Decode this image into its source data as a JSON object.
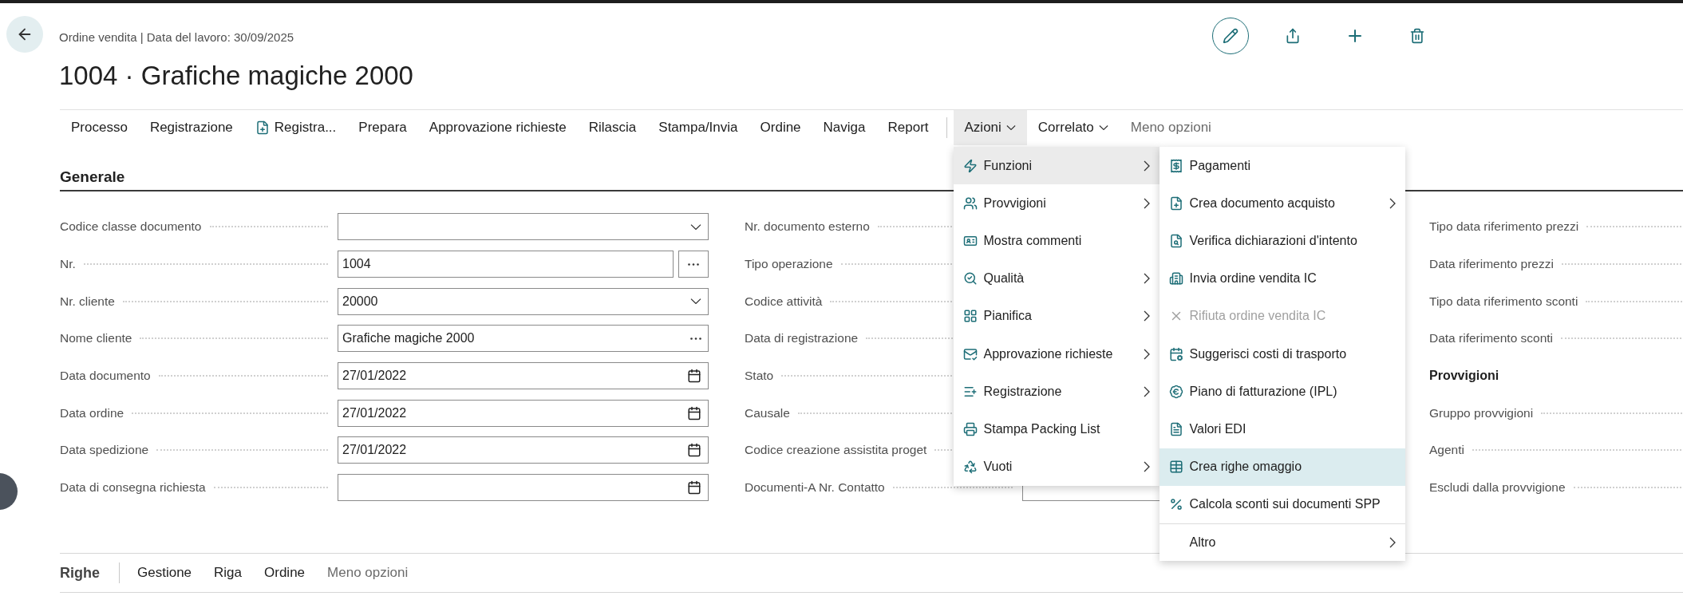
{
  "header": {
    "breadcrumb": "Ordine vendita | Data del lavoro: 30/09/2025",
    "title": "1004 · Grafiche magiche 2000"
  },
  "action_bar": {
    "primary": [
      {
        "label": "Processo",
        "kind": "text"
      },
      {
        "label": "Registrazione",
        "kind": "text"
      },
      {
        "label": "Registra...",
        "kind": "icon"
      },
      {
        "label": "Prepara",
        "kind": "text"
      },
      {
        "label": "Approvazione richieste",
        "kind": "text"
      },
      {
        "label": "Rilascia",
        "kind": "text"
      },
      {
        "label": "Stampa/Invia",
        "kind": "text"
      },
      {
        "label": "Ordine",
        "kind": "text"
      },
      {
        "label": "Naviga",
        "kind": "text"
      },
      {
        "label": "Report",
        "kind": "text"
      }
    ],
    "secondary": [
      {
        "label": "Azioni",
        "kind": "dropdown",
        "expanded": true
      },
      {
        "label": "Correlato",
        "kind": "dropdown",
        "expanded": false
      },
      {
        "label": "Meno opzioni",
        "kind": "muted",
        "expanded": false
      }
    ]
  },
  "actions_menu": {
    "items": [
      {
        "label": "Funzioni",
        "has_submenu": true,
        "selected": true
      },
      {
        "label": "Provvigioni",
        "has_submenu": true,
        "selected": false
      },
      {
        "label": "Mostra commenti",
        "has_submenu": false,
        "selected": false
      },
      {
        "label": "Qualità",
        "has_submenu": true,
        "selected": false
      },
      {
        "label": "Pianifica",
        "has_submenu": true,
        "selected": false
      },
      {
        "label": "Approvazione richieste",
        "has_submenu": true,
        "selected": false
      },
      {
        "label": "Registrazione",
        "has_submenu": true,
        "selected": false
      },
      {
        "label": "Stampa Packing List",
        "has_submenu": false,
        "selected": false
      },
      {
        "label": "Vuoti",
        "has_submenu": true,
        "selected": false
      }
    ],
    "submenu": [
      {
        "label": "Pagamenti",
        "kind": "action",
        "has_submenu": false,
        "disabled": false,
        "selected": false
      },
      {
        "label": "Crea documento acquisto",
        "kind": "action",
        "has_submenu": true,
        "disabled": false,
        "selected": false
      },
      {
        "label": "Verifica dichiarazioni d'intento",
        "kind": "action",
        "has_submenu": false,
        "disabled": false,
        "selected": false
      },
      {
        "label": "Invia ordine vendita IC",
        "kind": "action",
        "has_submenu": false,
        "disabled": false,
        "selected": false
      },
      {
        "label": "Rifiuta ordine vendita IC",
        "kind": "action",
        "has_submenu": false,
        "disabled": true,
        "selected": false
      },
      {
        "label": "Suggerisci costi di trasporto",
        "kind": "action",
        "has_submenu": false,
        "disabled": false,
        "selected": false
      },
      {
        "label": "Piano di fatturazione (IPL)",
        "kind": "action",
        "has_submenu": false,
        "disabled": false,
        "selected": false
      },
      {
        "label": "Valori EDI",
        "kind": "action",
        "has_submenu": false,
        "disabled": false,
        "selected": false
      },
      {
        "label": "Crea righe omaggio",
        "kind": "action",
        "has_submenu": false,
        "disabled": false,
        "selected": true
      },
      {
        "label": "Calcola sconti sui documenti SPP",
        "kind": "action",
        "has_submenu": false,
        "disabled": false,
        "selected": false
      },
      {
        "label": "Altro",
        "kind": "more",
        "has_submenu": true,
        "disabled": false,
        "selected": false
      }
    ]
  },
  "general": {
    "title": "Generale",
    "column_1": [
      {
        "label": "Codice classe documento",
        "kind": "dropdown"
      },
      {
        "label": "Nr.",
        "kind": "assist",
        "value": "1004"
      },
      {
        "label": "Nr. cliente",
        "kind": "dropdown",
        "value": "20000"
      },
      {
        "label": "Nome cliente",
        "kind": "lookup",
        "value": "Grafiche magiche 2000"
      },
      {
        "label": "Data documento",
        "kind": "date",
        "value": "27/01/2022"
      },
      {
        "label": "Data ordine",
        "kind": "date",
        "value": "27/01/2022"
      },
      {
        "label": "Data spedizione",
        "kind": "date",
        "value": "27/01/2022"
      },
      {
        "label": "Data di consegna richiesta",
        "kind": "date"
      }
    ],
    "column_2": [
      {
        "label": "Nr. documento esterno",
        "kind": "text"
      },
      {
        "label": "Tipo operazione",
        "kind": "text"
      },
      {
        "label": "Codice attività",
        "kind": "text"
      },
      {
        "label": "Data di registrazione",
        "kind": "text"
      },
      {
        "label": "Stato",
        "kind": "text"
      },
      {
        "label": "Causale",
        "kind": "text"
      },
      {
        "label": "Codice creazione assistita proget",
        "kind": "text"
      },
      {
        "label": "Documenti-A Nr. Contatto",
        "kind": "text"
      }
    ],
    "column_3": [
      {
        "label": "Tipo data riferimento prezzi",
        "kind": "field"
      },
      {
        "label": "Data riferimento prezzi",
        "kind": "field"
      },
      {
        "label": "Tipo data riferimento sconti",
        "kind": "field"
      },
      {
        "label": "Data riferimento sconti",
        "kind": "field"
      },
      {
        "label": "Provvigioni",
        "kind": "heading"
      },
      {
        "label": "Gruppo provvigioni",
        "kind": "field"
      },
      {
        "label": "Agenti",
        "kind": "field"
      },
      {
        "label": "Escludi dalla provvigione",
        "kind": "field"
      }
    ]
  },
  "lines": {
    "title": "Righe",
    "actions": [
      {
        "label": "Gestione",
        "kind": "text"
      },
      {
        "label": "Riga",
        "kind": "text"
      },
      {
        "label": "Ordine",
        "kind": "text"
      },
      {
        "label": "Meno opzioni",
        "kind": "muted"
      }
    ]
  }
}
